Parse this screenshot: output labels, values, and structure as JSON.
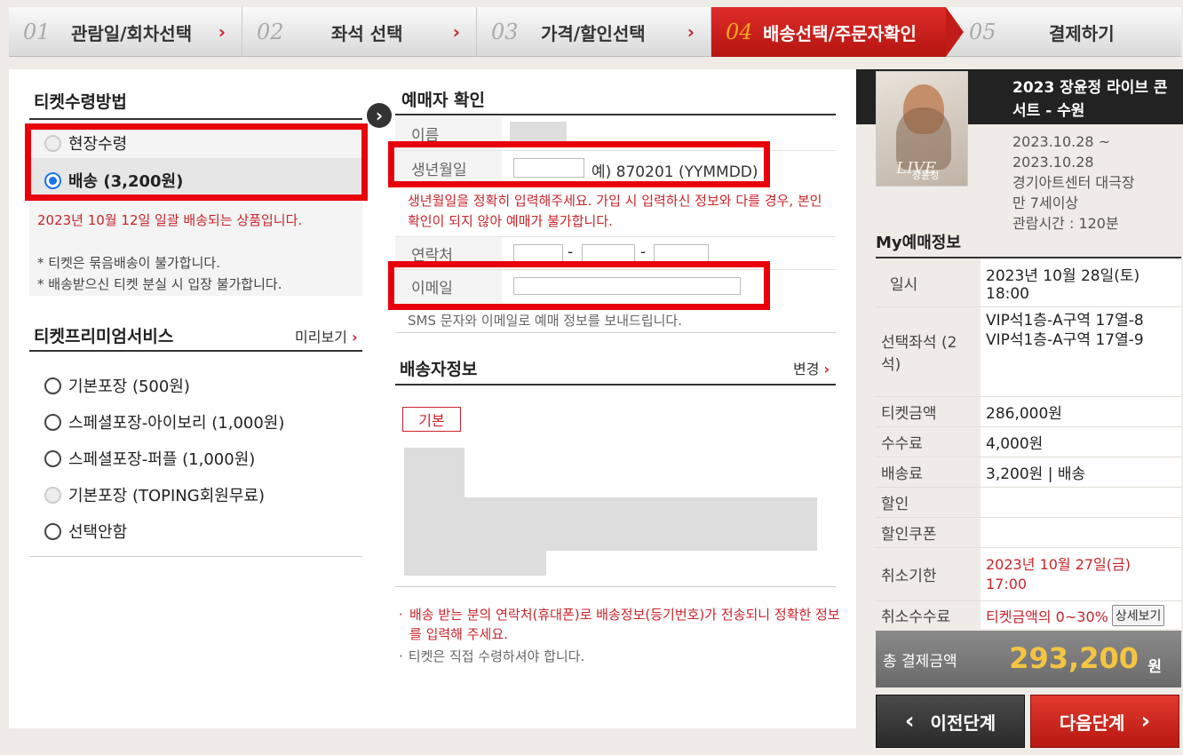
{
  "steps": [
    {
      "num": "01",
      "label": "관람일/회차선택",
      "arrow": "›"
    },
    {
      "num": "02",
      "label": "좌석 선택",
      "arrow": "›"
    },
    {
      "num": "03",
      "label": "가격/할인선택",
      "arrow": "›"
    },
    {
      "num": "04",
      "label": "배송선택/주문자확인",
      "arrow": ""
    },
    {
      "num": "05",
      "label": "결제하기",
      "arrow": ""
    }
  ],
  "ticket_receive": {
    "title": "티켓수령방법",
    "options": [
      {
        "label": "현장수령",
        "state": "disabled"
      },
      {
        "label": "배송 (3,200원)",
        "state": "selected"
      }
    ],
    "notice": "2023년 10월 12일 일괄 배송되는 상품입니다.",
    "notes": [
      "* 티켓은 묶음배송이 불가합니다.",
      "* 배송받으신 티켓 분실 시 입장 불가합니다."
    ]
  },
  "premium": {
    "title": "티켓프리미엄서비스",
    "preview": "미리보기",
    "options": [
      "기본포장 (500원)",
      "스페셜포장-아이보리 (1,000원)",
      "스페셜포장-퍼플 (1,000원)",
      "기본포장 (TOPING회원무료)",
      "선택안함"
    ]
  },
  "booker": {
    "title": "예매자 확인",
    "name_label": "이름",
    "birth_label": "생년월일",
    "birth_value": "",
    "birth_hint": "예) 870201 (YYMMDD)",
    "birth_warning": "생년월일을 정확히 입력해주세요. 가입 시 입력하신 정보와 다를 경우, 본인확인이 되지 않아 예매가 불가합니다.",
    "phone_label": "연락처",
    "email_label": "이메일",
    "email_value": "",
    "sms_note": "SMS 문자와 이메일로 예매 정보를 보내드립니다."
  },
  "delivery": {
    "title": "배송자정보",
    "change": "변경",
    "basic_tag": "기본",
    "notes": [
      "배송 받는 분의 연락처(휴대폰)로 배송정보(등기번호)가 전송되니 정확한 정보를 입력해 주세요.",
      "티켓은 직접 수령하셔야 합니다."
    ]
  },
  "event": {
    "title": "2023 장윤정 라이브 콘서트 - 수원",
    "dates": "2023.10.28 ~ 2023.10.28",
    "venue": "경기아트센터 대극장",
    "age": "만 7세이상",
    "runtime": "관람시간 : 120분",
    "poster_text": "장윤정",
    "poster_script": "LIVE"
  },
  "my": {
    "title": "My예매정보",
    "rows": [
      {
        "k": "일시",
        "v": "2023년 10월 28일(토) 18:00"
      },
      {
        "k": "선택좌석 (2석)",
        "v": "VIP석1층-A구역 17열-8\nVIP석1층-A구역 17열-9"
      },
      {
        "k": "티켓금액",
        "v": "286,000원"
      },
      {
        "k": "수수료",
        "v": "4,000원"
      },
      {
        "k": "배송료",
        "v": "3,200원 | 배송"
      },
      {
        "k": "할인",
        "v": ""
      },
      {
        "k": "할인쿠폰",
        "v": ""
      },
      {
        "k": "취소기한",
        "v": "2023년 10월 27일(금) 17:00"
      },
      {
        "k": "취소수수료",
        "v": "티켓금액의 0~30%"
      }
    ],
    "detail_btn": "상세보기",
    "total_label": "총 결제금액",
    "total_value": "293,200",
    "total_unit": "원"
  },
  "nav": {
    "prev": "이전단계",
    "next": "다음단계"
  },
  "colors": {
    "accent": "#c9242b",
    "active_step": "#d2201d",
    "total_amount": "#f4c542",
    "highlight_box": "#e8000b"
  }
}
